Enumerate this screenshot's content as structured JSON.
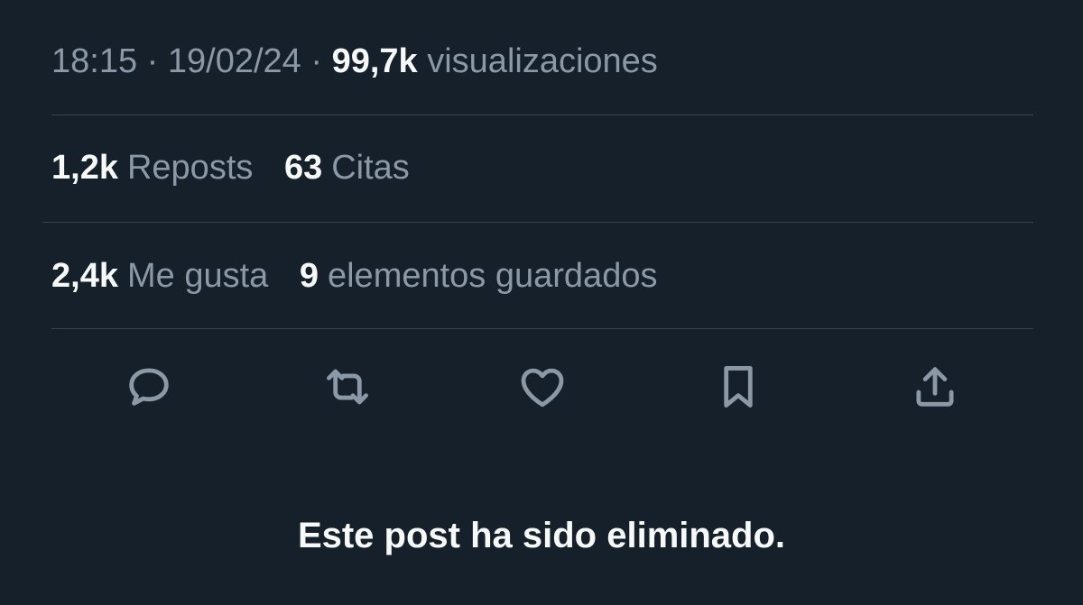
{
  "meta": {
    "time": "18:15",
    "separator": "·",
    "date": "19/02/24",
    "views_count": "99,7k",
    "views_label": "visualizaciones"
  },
  "stats_row1": [
    {
      "count": "1,2k",
      "label": "Reposts"
    },
    {
      "count": "63",
      "label": "Citas"
    }
  ],
  "stats_row2": [
    {
      "count": "2,4k",
      "label": "Me gusta"
    },
    {
      "count": "9",
      "label": "elementos guardados"
    }
  ],
  "actions": [
    "reply-icon",
    "repost-icon",
    "like-icon",
    "bookmark-icon",
    "share-icon"
  ],
  "deleted_notice": "Este post ha sido eliminado.",
  "colors": {
    "background": "#15202b",
    "primary_text": "#f7f9f9",
    "secondary_text": "#8b98a5",
    "divider": "#38444d"
  }
}
